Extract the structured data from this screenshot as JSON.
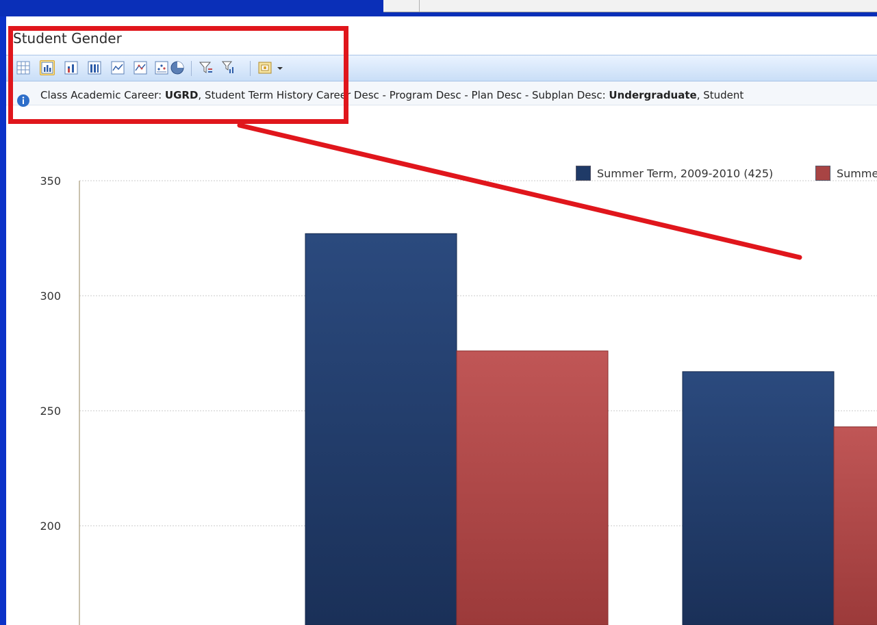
{
  "widget": {
    "title": "Student Gender",
    "filter": {
      "part1_label": "Class Academic Career: ",
      "part1_value": "UGRD",
      "part2_label": ", Student Term History Career Desc - Program Desc - Plan Desc - Subplan Desc: ",
      "part2_value": "Undergraduate",
      "part3_label": ", Student"
    },
    "toolbar_icons": [
      "grid-view-icon",
      "column-chart-icon",
      "stacked-column-icon",
      "percent-column-icon",
      "line-chart-icon",
      "scatter-chart-icon",
      "pie-chart-icon",
      "filter-icon",
      "filter-chart-icon",
      "export-icon",
      "dropdown-arrow-icon"
    ]
  },
  "chart_data": {
    "type": "bar",
    "categories": [
      "",
      ""
    ],
    "series": [
      {
        "name": "Summer Term, 2009-2010 (425)",
        "color": "#1f3a67",
        "values": [
          327,
          267
        ]
      },
      {
        "name": "Summe",
        "color": "#a84444",
        "values": [
          276,
          243
        ]
      }
    ],
    "ylim": [
      150,
      350
    ],
    "yticks": [
      200,
      250,
      300,
      350
    ],
    "grid": true,
    "legend": "top-right"
  },
  "colors": {
    "accent_red": "#e0161c",
    "bar_blue": "#1f3a67",
    "bar_red": "#a84444",
    "background": "#0b32c8"
  }
}
